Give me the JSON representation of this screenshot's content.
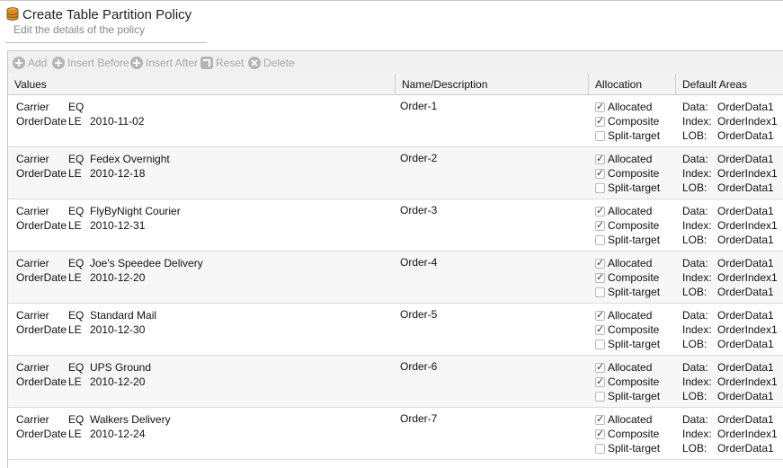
{
  "header": {
    "title": "Create Table Partition Policy",
    "subtitle": "Edit the details of the policy",
    "icon": "database-icon"
  },
  "toolbar": {
    "add": "Add",
    "insert_before": "Insert Before",
    "insert_after": "Insert After",
    "reset": "Reset",
    "delete": "Delete"
  },
  "columns": {
    "values": "Values",
    "name": "Name/Description",
    "allocation": "Allocation",
    "areas": "Default Areas"
  },
  "labels": {
    "carrier": "Carrier",
    "orderdate": "OrderDate",
    "eq": "EQ",
    "le": "LE",
    "allocated": "Allocated",
    "composite": "Composite",
    "split_target": "Split-target",
    "data": "Data:",
    "index": "Index:",
    "lob": "LOB:"
  },
  "rows": [
    {
      "carrier": "",
      "date": "2010-11-02",
      "name": "Order-1",
      "allocated": true,
      "composite": true,
      "split_target": false,
      "data_area": "OrderData1",
      "index_area": "OrderIndex1",
      "lob_area": "OrderData1"
    },
    {
      "carrier": "Fedex Overnight",
      "date": "2010-12-18",
      "name": "Order-2",
      "allocated": true,
      "composite": true,
      "split_target": false,
      "data_area": "OrderData1",
      "index_area": "OrderIndex1",
      "lob_area": "OrderData1"
    },
    {
      "carrier": "FlyByNight Courier",
      "date": "2010-12-31",
      "name": "Order-3",
      "allocated": true,
      "composite": true,
      "split_target": false,
      "data_area": "OrderData1",
      "index_area": "OrderIndex1",
      "lob_area": "OrderData1"
    },
    {
      "carrier": "Joe's Speedee Delivery",
      "date": "2010-12-20",
      "name": "Order-4",
      "allocated": true,
      "composite": true,
      "split_target": false,
      "data_area": "OrderData1",
      "index_area": "OrderIndex1",
      "lob_area": "OrderData1"
    },
    {
      "carrier": "Standard Mail",
      "date": "2010-12-30",
      "name": "Order-5",
      "allocated": true,
      "composite": true,
      "split_target": false,
      "data_area": "OrderData1",
      "index_area": "OrderIndex1",
      "lob_area": "OrderData1"
    },
    {
      "carrier": "UPS Ground",
      "date": "2010-12-20",
      "name": "Order-6",
      "allocated": true,
      "composite": true,
      "split_target": false,
      "data_area": "OrderData1",
      "index_area": "OrderIndex1",
      "lob_area": "OrderData1"
    },
    {
      "carrier": "Walkers Delivery",
      "date": "2010-12-24",
      "name": "Order-7",
      "allocated": true,
      "composite": true,
      "split_target": false,
      "data_area": "OrderData1",
      "index_area": "OrderIndex1",
      "lob_area": "OrderData1"
    }
  ]
}
